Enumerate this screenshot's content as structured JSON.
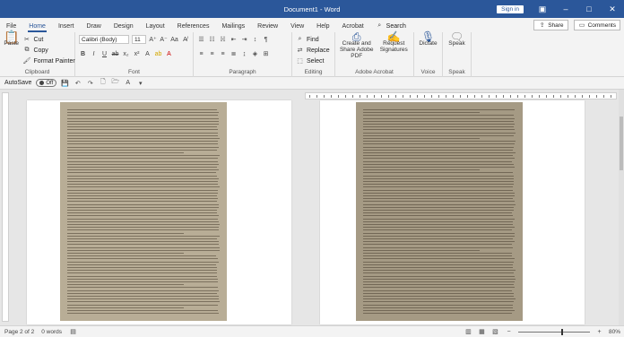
{
  "window": {
    "title": "Document1 - Word",
    "signin_label": "Sign in",
    "colors": {
      "titlebar": "#2b579a",
      "accent": "#2b579a"
    }
  },
  "tabs": [
    "File",
    "Home",
    "Insert",
    "Draw",
    "Design",
    "Layout",
    "References",
    "Mailings",
    "Review",
    "View",
    "Help",
    "Acrobat"
  ],
  "active_tab": "Home",
  "search_label": "Search",
  "share_label": "Share",
  "comments_label": "Comments",
  "ribbon": {
    "clipboard": {
      "paste": "Paste",
      "cut": "Cut",
      "copy": "Copy",
      "format_painter": "Format Painter",
      "label": "Clipboard"
    },
    "font": {
      "name": "Calibri (Body)",
      "size": "11",
      "label": "Font"
    },
    "paragraph": {
      "label": "Paragraph"
    },
    "editing": {
      "find": "Find",
      "replace": "Replace",
      "select": "Select",
      "label": "Editing"
    },
    "acrobat": {
      "create_share": "Create and Share Adobe PDF",
      "request_signatures": "Request Signatures",
      "label": "Adobe Acrobat"
    },
    "voice": {
      "dictate": "Dictate",
      "label": "Voice"
    },
    "speak": {
      "speak": "Speak",
      "label": "Speak"
    }
  },
  "quick_access": {
    "autosave_label": "AutoSave",
    "autosave_state": "Off"
  },
  "status": {
    "page": "Page 2 of 2",
    "words": "0 words",
    "zoom": "80%",
    "zoom_fraction": 0.62
  }
}
